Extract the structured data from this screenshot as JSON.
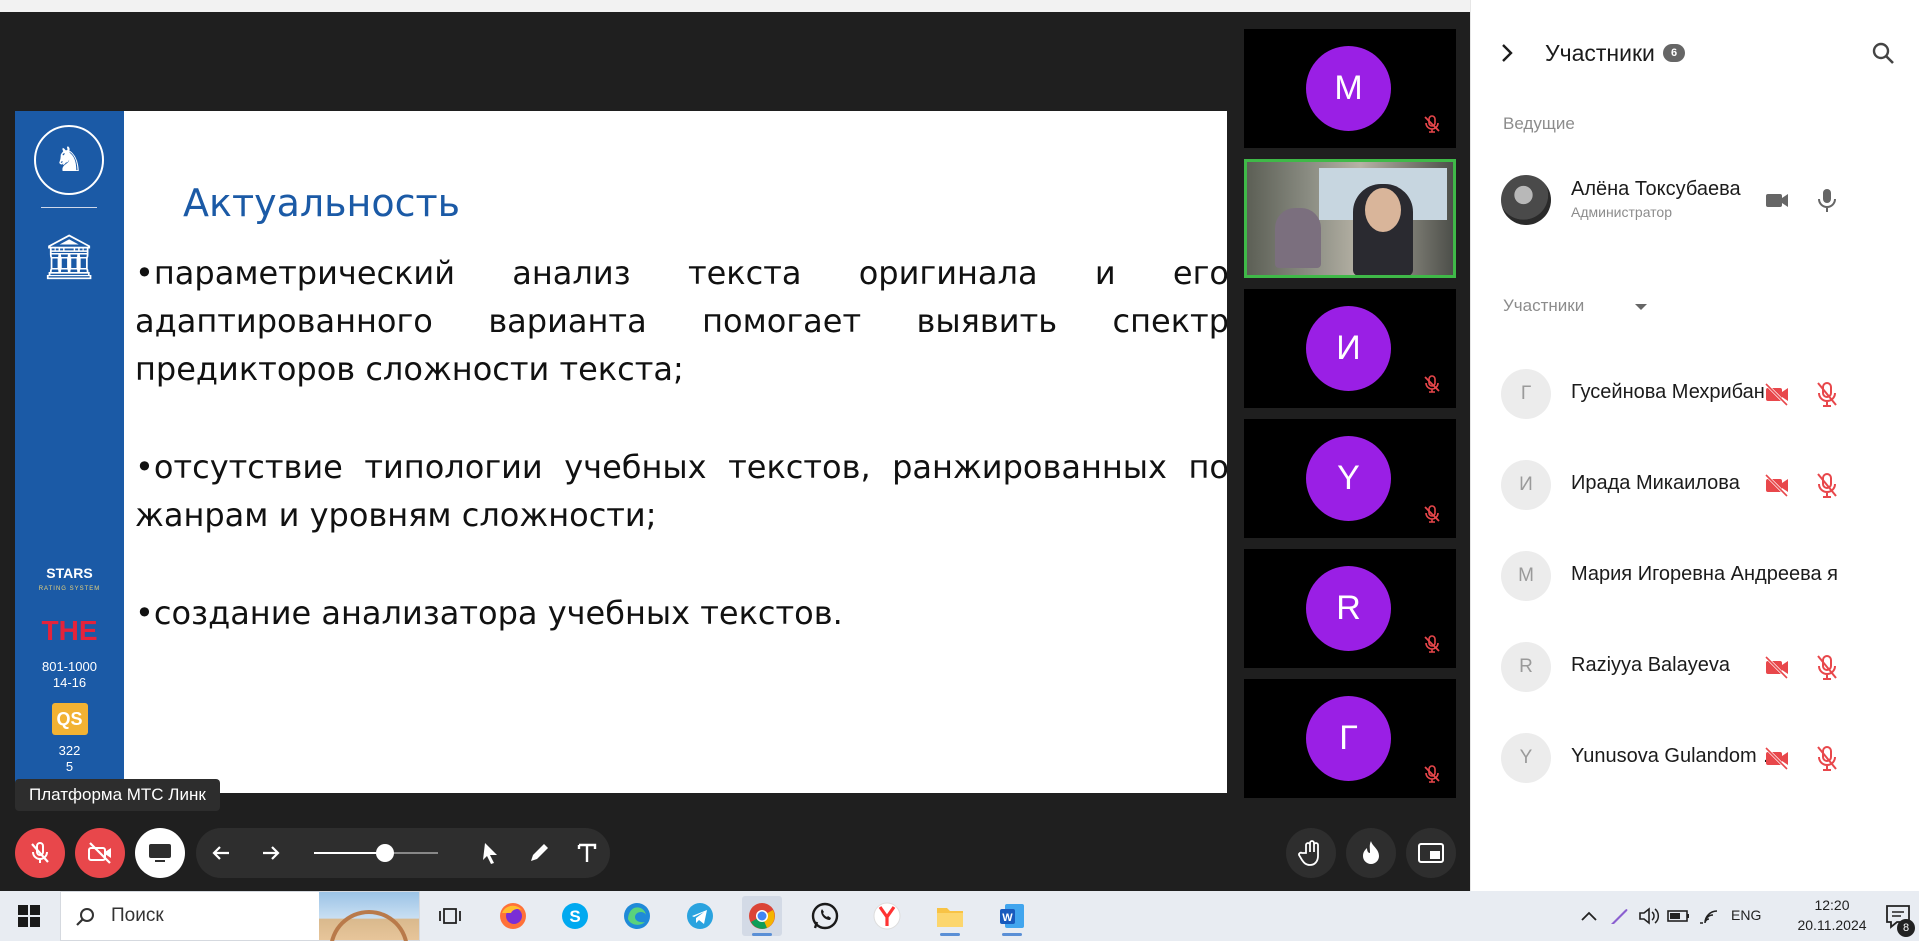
{
  "slide": {
    "title": "Актуальность",
    "bullets": [
      "•параметрический анализ текста оригинала и его адаптированного варианта помогает выявить спектр предикторов сложности текста;",
      "•отсутствие типологии учебных текстов, ранжированных по жанрам и уровням сложности;",
      "•создание анализатора учебных текстов."
    ],
    "sidebar": {
      "stars_title": "STARS",
      "stars_sub": "RATING SYSTEM",
      "the_logo": "THE",
      "the_rank_1": "801-1000",
      "the_rank_2": "14-16",
      "qs_logo": "QS",
      "qs_rank_1": "322",
      "qs_rank_2": "5"
    }
  },
  "tooltip": "Платформа МТС Линк",
  "tiles": [
    {
      "letter": "М",
      "muted": true
    },
    {
      "letter": "",
      "video": true
    },
    {
      "letter": "И",
      "muted": true
    },
    {
      "letter": "Y",
      "muted": true
    },
    {
      "letter": "R",
      "muted": true
    },
    {
      "letter": "Г",
      "muted": true
    }
  ],
  "toolbar": {
    "zoom_level": 0.57,
    "buttons": [
      "mic-off",
      "camera-off",
      "screen-share",
      "arrow-left",
      "arrow-right",
      "pointer",
      "pen",
      "text",
      "raise-hand",
      "reaction",
      "layout"
    ]
  },
  "panel": {
    "title": "Участники",
    "count": "6",
    "hosts_label": "Ведущие",
    "host": {
      "name": "Алёна Токсубаева",
      "role": "Администратор"
    },
    "participants_label": "Участники",
    "participants": [
      {
        "initial": "Г",
        "name": "Гусейнова Мехрибан",
        "controls": true
      },
      {
        "initial": "И",
        "name": "Ирада Микаилова",
        "controls": true
      },
      {
        "initial": "М",
        "name": "Мария Игоревна Андреева я",
        "controls": false
      },
      {
        "initial": "R",
        "name": "Raziyya Balayeva",
        "controls": true
      },
      {
        "initial": "Y",
        "name": "Yunusova Gulandom Rustamovna",
        "controls": true
      }
    ]
  },
  "colors": {
    "accent_purple": "#9a1fe5",
    "danger_red": "#e8474b",
    "slide_blue": "#1b5aa6",
    "active_green": "#3fb948"
  },
  "taskbar": {
    "search_placeholder": "Поиск",
    "apps": [
      "task-view",
      "firefox",
      "skype",
      "edge",
      "telegram",
      "chrome",
      "whatsapp",
      "yandex-browser",
      "file-explorer",
      "word"
    ],
    "active_app": "chrome",
    "lang": "ENG",
    "time": "12:20",
    "date": "20.11.2024",
    "notification_count": "8"
  }
}
